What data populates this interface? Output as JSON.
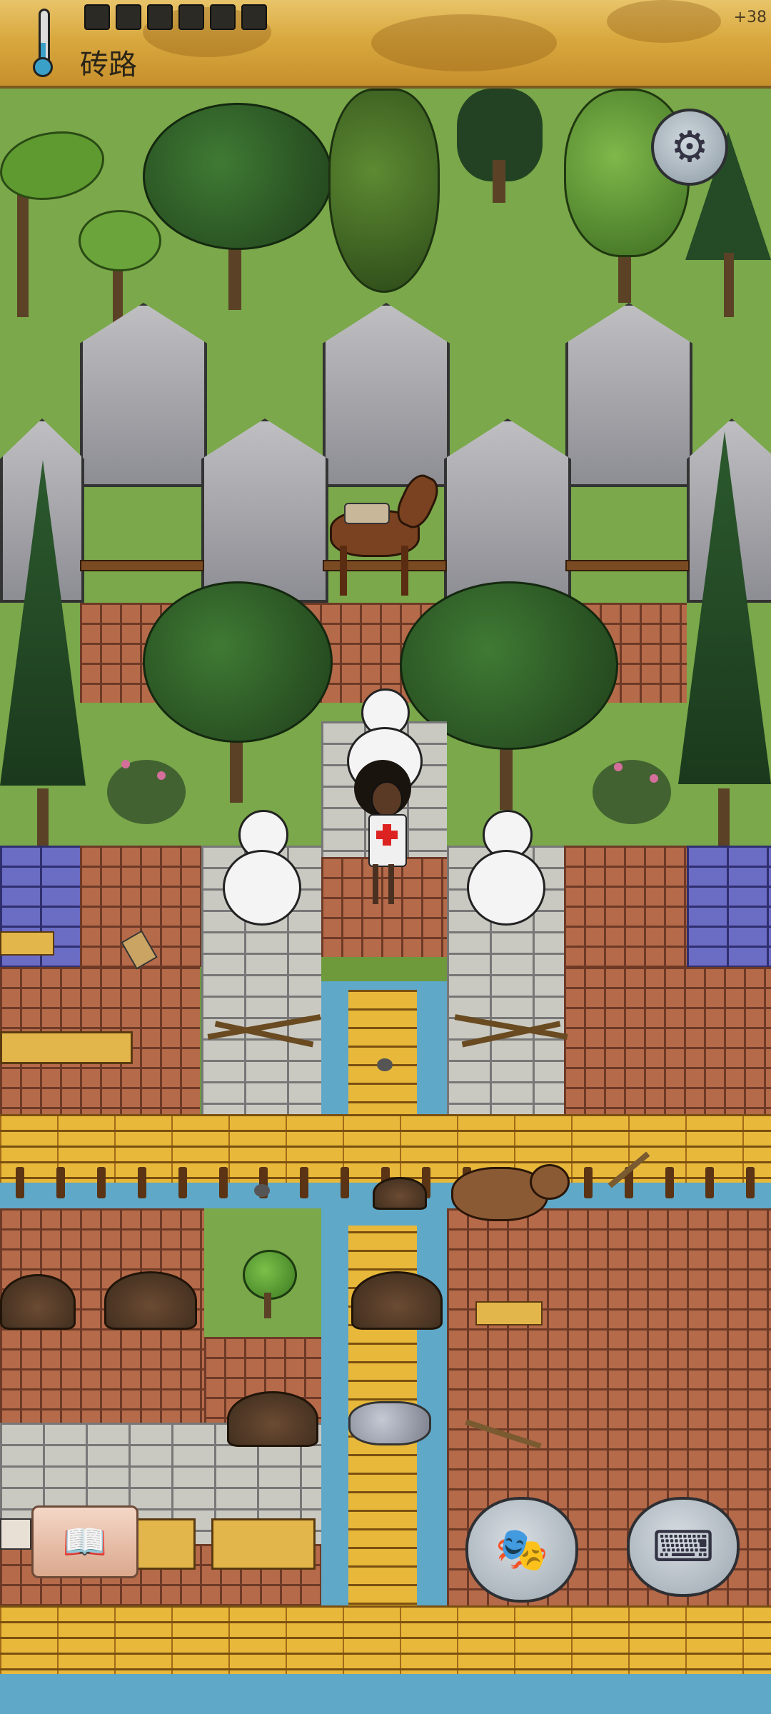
{
  "status_bar": {
    "location_name": "砖路",
    "yum_bonus": "+38",
    "food_pips_filled": 6
  },
  "icons": {
    "settings": "gear-icon",
    "thermometer": "thermometer-icon",
    "tech_tree": "book-icon",
    "emote": "puppet-icon",
    "keyboard": "keyboard-icon"
  },
  "colors": {
    "grass": "#7aa84a",
    "brick": "#b56a4a",
    "plank": "#e8b83a",
    "water": "#5fa8c8"
  }
}
